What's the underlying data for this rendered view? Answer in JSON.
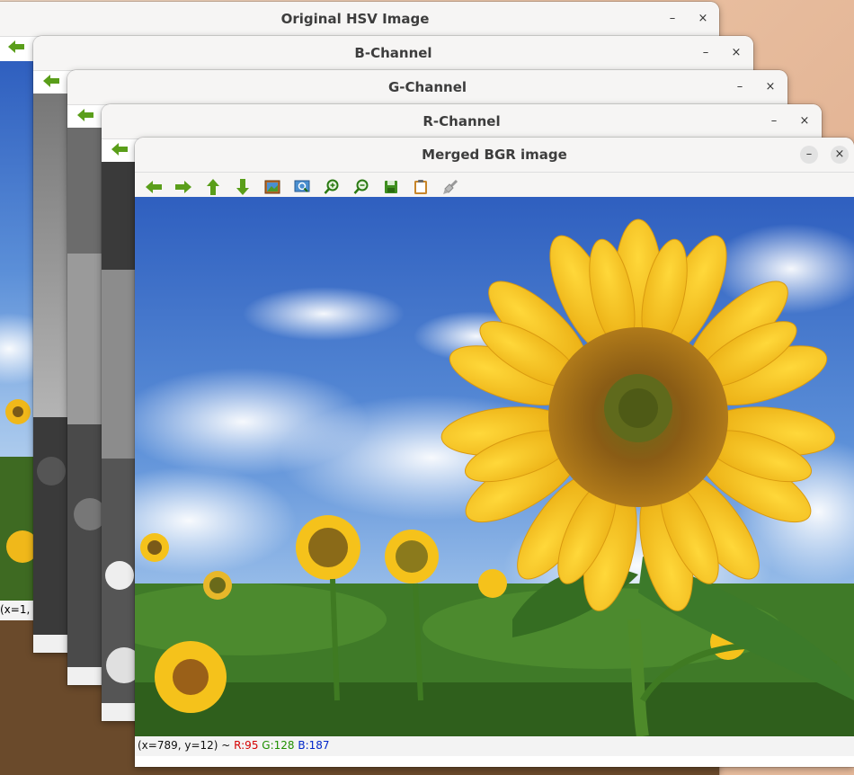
{
  "windows": {
    "hsv": {
      "title": "Original HSV Image",
      "status_fragment": "(x=1,"
    },
    "b": {
      "title": "B-Channel"
    },
    "g": {
      "title": "G-Channel"
    },
    "r": {
      "title": "R-Channel"
    },
    "merged": {
      "title": "Merged BGR image",
      "status": {
        "coords": "(x=789, y=12) ~ ",
        "r": "R:95",
        "g": "G:128",
        "b": "B:187"
      }
    }
  },
  "title_controls": {
    "minimize": "–",
    "close": "×"
  },
  "toolbar_tools": [
    "back-arrow-icon",
    "forward-arrow-icon",
    "up-arrow-icon",
    "down-arrow-icon",
    "image-icon",
    "zoom-fit-icon",
    "zoom-in-icon",
    "zoom-out-icon",
    "save-icon",
    "clipboard-icon",
    "brush-icon"
  ],
  "colors": {
    "arrow_green": "#5a9e1a",
    "sky_blue": "#3a6fc8",
    "petal_yellow": "#f5c21b"
  }
}
